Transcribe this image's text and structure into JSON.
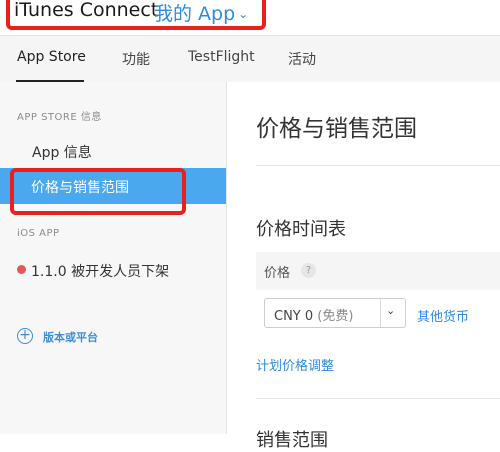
{
  "header": {
    "brand": "iTunes Connect",
    "app_menu": "我的 App",
    "app_menu_chevron": "⌄"
  },
  "tabs": [
    {
      "label": "App Store",
      "active": true
    },
    {
      "label": "功能",
      "active": false
    },
    {
      "label": "TestFlight",
      "active": false
    },
    {
      "label": "活动",
      "active": false
    }
  ],
  "sidebar": {
    "section_store": "APP STORE 信息",
    "items": [
      {
        "label": "App 信息"
      },
      {
        "label": "价格与销售范围",
        "selected": true
      }
    ],
    "section_ios": "iOS APP",
    "version_item": {
      "label": "1.1.0 被开发人员下架",
      "status_color": "#e4575b"
    },
    "add_button": {
      "icon": "+",
      "label": "版本或平台"
    }
  },
  "main": {
    "title": "价格与销售范围",
    "schedule_title": "价格时间表",
    "price_label": "价格",
    "help_icon": "?",
    "price_select": {
      "value": "CNY 0",
      "note": "(免费)",
      "chevron": "⌄"
    },
    "other_currency_link": "其他货币",
    "plan_price_link": "计划价格调整",
    "next_section_title": "销售范围"
  },
  "colors": {
    "accent_blue": "#2f8be0",
    "selected_bg": "#4aa8ef",
    "highlight_red": "#e8211d"
  }
}
